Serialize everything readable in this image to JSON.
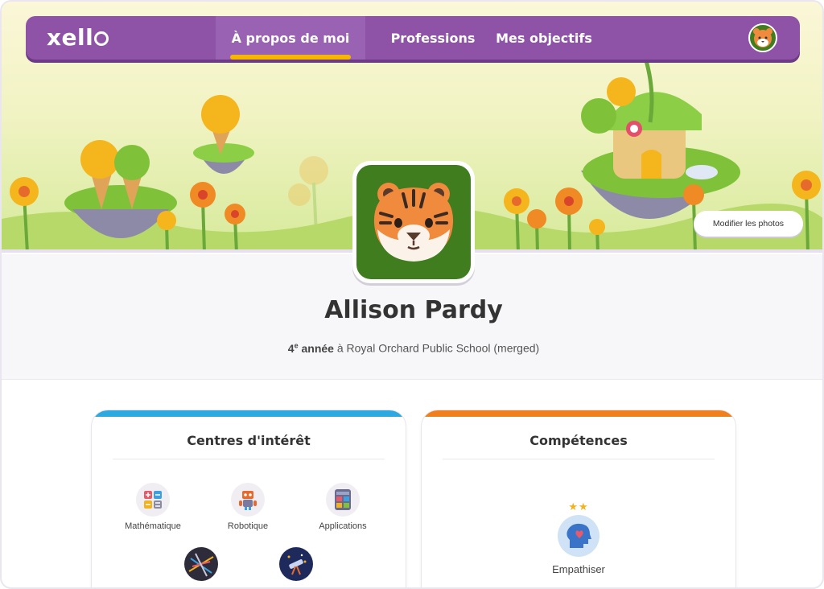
{
  "nav": {
    "logo": "xell",
    "tabs": [
      {
        "label": "À propos de moi",
        "active": true
      },
      {
        "label": "Professions",
        "active": false
      },
      {
        "label": "Mes objectifs",
        "active": false
      }
    ]
  },
  "hero": {
    "modify_button": "Modifier les photos"
  },
  "profile": {
    "name": "Allison Pardy",
    "grade_number": "4",
    "grade_sup": "e",
    "grade_word": "année",
    "school_text": "à Royal Orchard Public School (merged)"
  },
  "cards": {
    "interests": {
      "title": "Centres d'intérêt",
      "accent": "#2ea8e0",
      "items": [
        {
          "label": "Mathématique",
          "icon": "calculator-icon"
        },
        {
          "label": "Robotique",
          "icon": "robot-icon"
        },
        {
          "label": "Applications",
          "icon": "app-screen-icon"
        },
        {
          "label": "",
          "icon": "lines-icon"
        },
        {
          "label": "",
          "icon": "telescope-icon"
        }
      ]
    },
    "skills": {
      "title": "Compétences",
      "accent": "#f07f1e",
      "items": [
        {
          "label": "Empathiser",
          "stars": "★★",
          "icon": "empathy-head-icon"
        }
      ]
    }
  },
  "colors": {
    "nav_purple": "#8e53a6",
    "tab_underline": "#f5b700",
    "avatar_green": "#3f7d1f"
  }
}
